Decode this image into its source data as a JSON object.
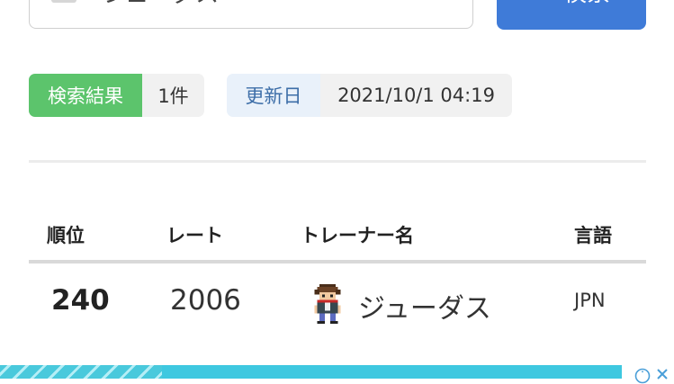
{
  "search": {
    "value": "ジューダス",
    "button_label": "検索"
  },
  "summary": {
    "results_label": "検索結果",
    "results_count": "1件",
    "updated_label": "更新日",
    "updated_value": "2021/10/1 04:19"
  },
  "table": {
    "headers": {
      "rank": "順位",
      "rate": "レート",
      "trainer": "トレーナー名",
      "language": "言語"
    },
    "rows": [
      {
        "rank": "240",
        "rate": "2006",
        "trainer": "ジューダス",
        "language": "JPN",
        "avatar_icon": "trainer-sprite-icon"
      }
    ]
  },
  "colors": {
    "accent": "#3f7bd8",
    "results_badge": "#5cc46c",
    "updated_badge_bg": "#e9f1fa",
    "updated_badge_text": "#3d6ea8"
  },
  "ad": {
    "icons": [
      "info-icon",
      "close-icon"
    ]
  }
}
